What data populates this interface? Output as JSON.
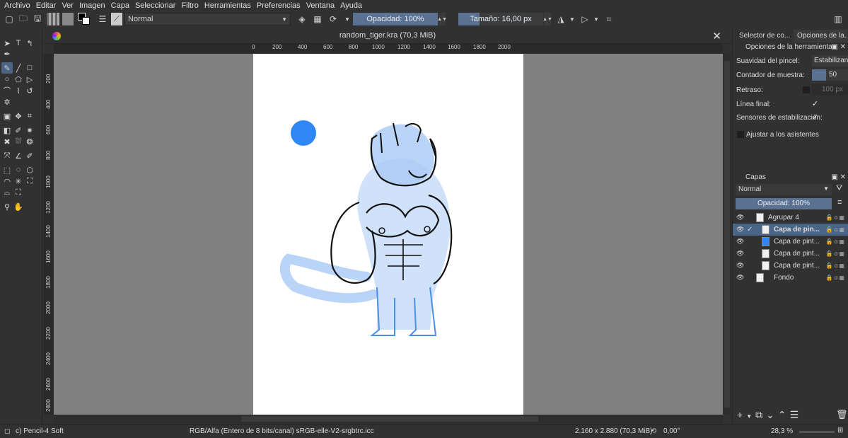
{
  "menu": [
    "Archivo",
    "Editar",
    "Ver",
    "Imagen",
    "Capa",
    "Seleccionar",
    "Filtro",
    "Herramientas",
    "Preferencias",
    "Ventana",
    "Ayuda"
  ],
  "toolbar": {
    "blend_mode": "Normal",
    "opacity_label": "Opacidad: 100%",
    "size_label": "Tamaño: 16,00 px"
  },
  "document": {
    "tab_title": "random_tiger.kra (70,3 MiB)",
    "close_glyph": "✕"
  },
  "rulers": {
    "horizontal": [
      "0",
      "200",
      "400",
      "600",
      "800",
      "1000",
      "1200",
      "1400",
      "1600",
      "1800",
      "2000"
    ],
    "vertical": [
      "200",
      "400",
      "600",
      "800",
      "1000",
      "1200",
      "1400",
      "1600",
      "1800",
      "2000",
      "2200",
      "2400",
      "2600",
      "2800"
    ]
  },
  "docker": {
    "tabs": [
      "Selector de co...",
      "Opciones de la..."
    ],
    "tool_options_title": "Opciones de la herramienta",
    "options": {
      "smoothing_label": "Suavidad del pincel:",
      "smoothing_value": "Estabilizante",
      "sample_label": "Contador de muestra:",
      "sample_value": "50",
      "delay_label": "Retraso:",
      "delay_value": "100 px",
      "finish_line_label": "Línea final:",
      "pressure_label": "Sensores de estabilización:",
      "snap_label": "Ajustar a los asistentes"
    },
    "layers_title": "Capas",
    "layer_blend": "Normal",
    "layer_opacity": "Opacidad:  100%",
    "layers": [
      {
        "name": "Agrupar 4",
        "active": false
      },
      {
        "name": "Capa de pin...",
        "active": true
      },
      {
        "name": "Capa de pint...",
        "active": false
      },
      {
        "name": "Capa de pint...",
        "active": false
      },
      {
        "name": "Capa de pint...",
        "active": false
      },
      {
        "name": "Fondo",
        "active": false
      }
    ]
  },
  "status": {
    "brush": "c) Pencil-4 Soft",
    "color_space": "RGB/Alfa (Entero de 8 bits/canal)  sRGB-elle-V2-srgbtrc.icc",
    "dimensions": "2.160 x 2.880 (70,3 MiB)",
    "rotation": "0,00°",
    "zoom": "28,3 %"
  },
  "colors": {
    "accent": "#4a6585",
    "sketch_blue": "#2f86f5",
    "canvas_bg": "#808080"
  }
}
